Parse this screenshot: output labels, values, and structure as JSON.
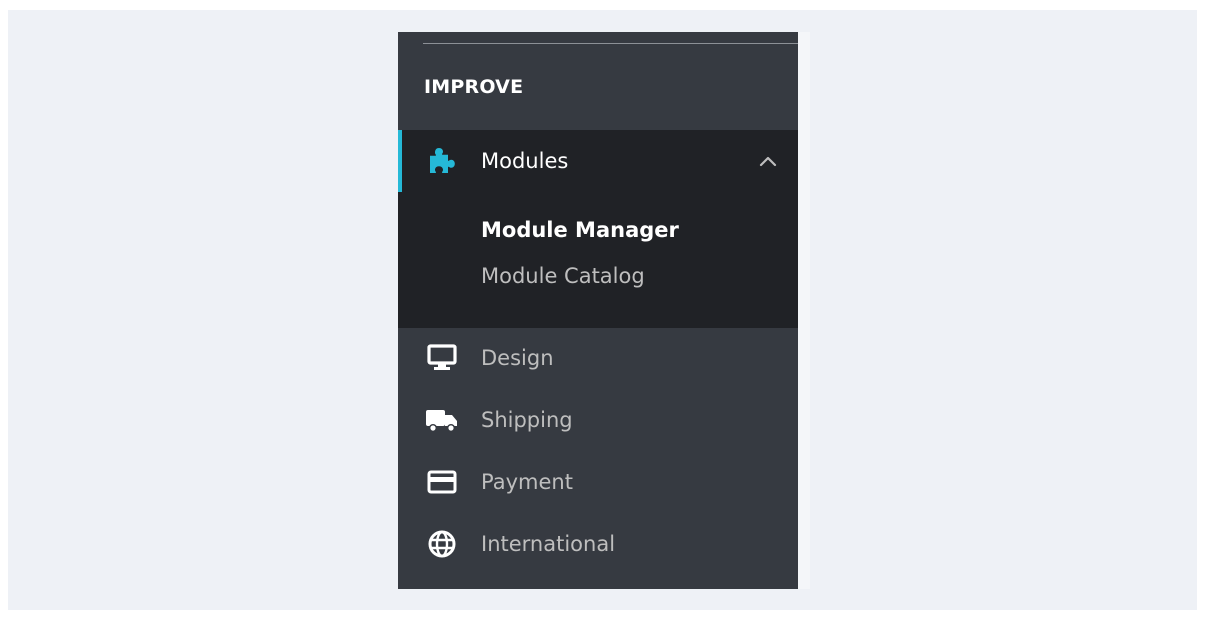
{
  "sidebar": {
    "section_title": "IMPROVE",
    "modules": {
      "label": "Modules",
      "icon": "puzzle-icon",
      "expanded": true,
      "submenu": [
        {
          "label": "Module Manager",
          "active": true
        },
        {
          "label": "Module Catalog",
          "active": false
        }
      ]
    },
    "items": [
      {
        "label": "Design",
        "icon": "monitor-icon"
      },
      {
        "label": "Shipping",
        "icon": "truck-icon"
      },
      {
        "label": "Payment",
        "icon": "credit-card-icon"
      },
      {
        "label": "International",
        "icon": "globe-icon"
      }
    ]
  },
  "colors": {
    "accent": "#25b9d7",
    "sidebar_bg": "#363a41",
    "active_block_bg": "#202226",
    "page_bg": "#eef1f6"
  }
}
